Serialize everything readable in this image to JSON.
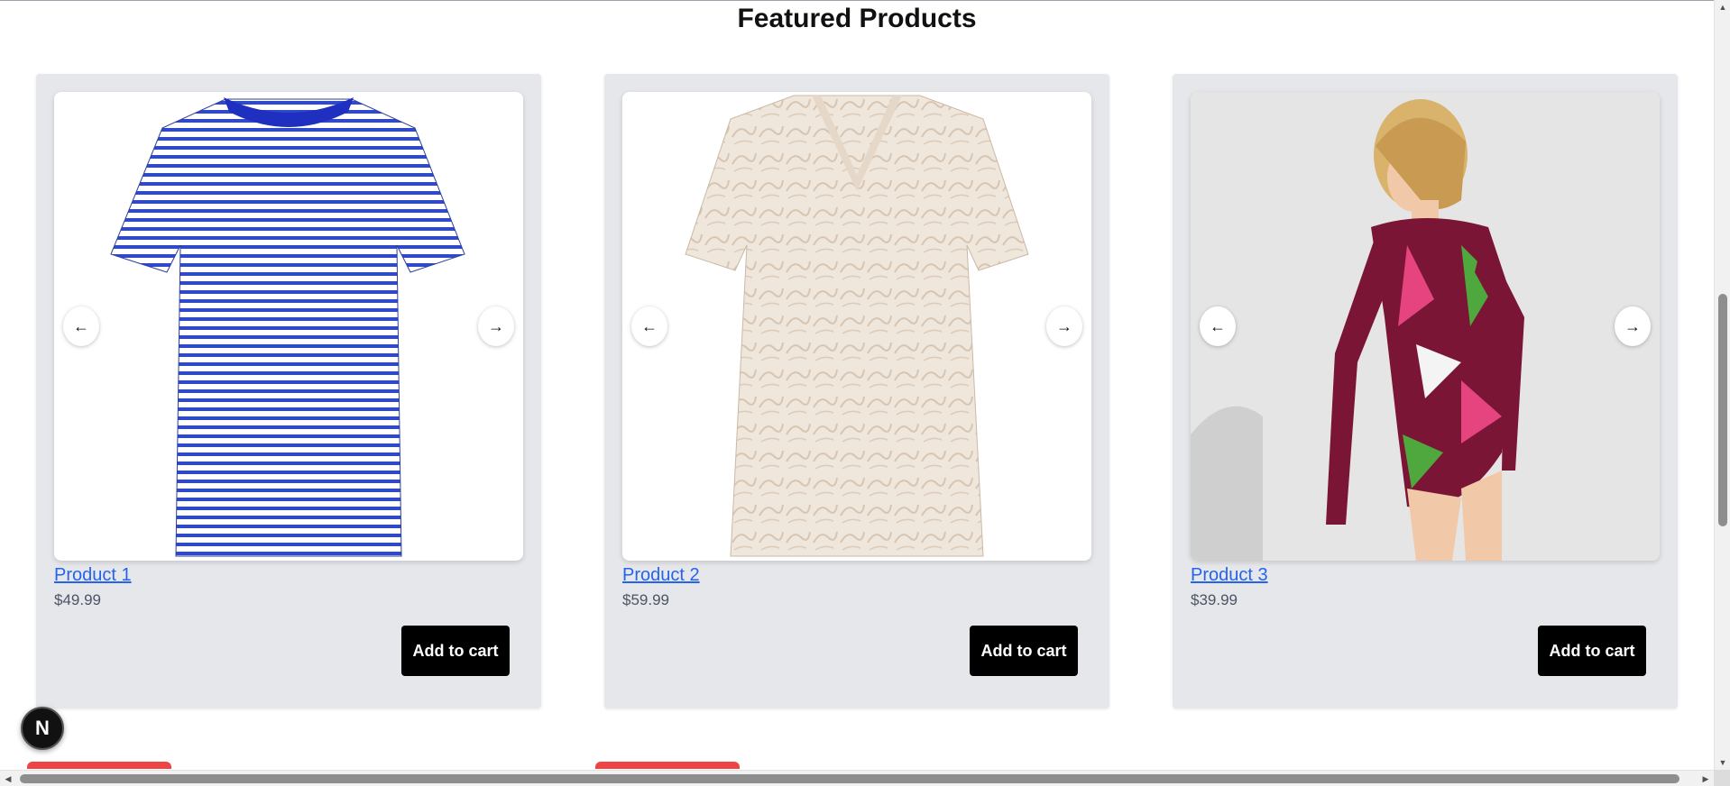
{
  "section": {
    "title": "Featured Products"
  },
  "products": [
    {
      "name": "Product 1",
      "price": "$49.99",
      "add_label": "Add to cart",
      "prev_arrow": "←",
      "next_arrow": "→",
      "image_desc": "striped-tshirt"
    },
    {
      "name": "Product 2",
      "price": "$59.99",
      "add_label": "Add to cart",
      "prev_arrow": "←",
      "next_arrow": "→",
      "image_desc": "printed-vneck-tshirt"
    },
    {
      "name": "Product 3",
      "price": "$39.99",
      "add_label": "Add to cart",
      "prev_arrow": "←",
      "next_arrow": "→",
      "image_desc": "floral-swimsuit"
    }
  ],
  "dev_badge": {
    "letter": "N"
  },
  "colors": {
    "card_bg": "#e5e7eb",
    "link": "#2563eb",
    "button_bg": "#000000",
    "accent_red": "#ef4444"
  },
  "icons": {
    "arrow_left": "arrow-left-icon",
    "arrow_right": "arrow-right-icon"
  }
}
